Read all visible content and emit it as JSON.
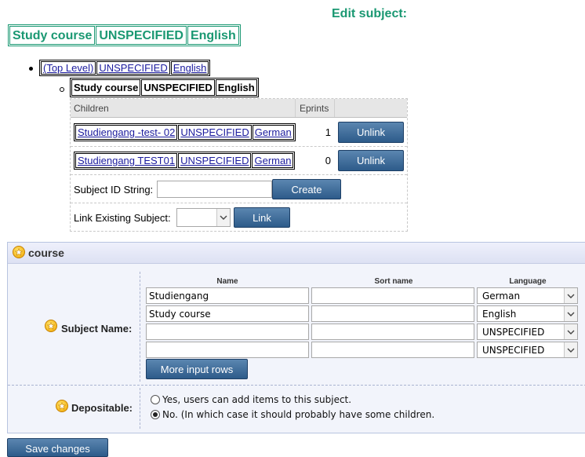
{
  "page_title": "Edit subject:",
  "subject_names": [
    "Study course",
    "UNSPECIFIED",
    "English"
  ],
  "tree": {
    "top_links": [
      "(Top Level)",
      "UNSPECIFIED",
      "English"
    ],
    "current": [
      "Study course",
      "UNSPECIFIED",
      "English"
    ]
  },
  "children_table": {
    "header_children": "Children",
    "header_eprints": "Eprints",
    "rows": [
      {
        "links": [
          "Studiengang -test- 02",
          "UNSPECIFIED",
          "German"
        ],
        "eprints": "1",
        "action": "Unlink"
      },
      {
        "links": [
          "Studiengang TEST01",
          "UNSPECIFIED",
          "German"
        ],
        "eprints": "0",
        "action": "Unlink"
      }
    ],
    "subject_id_label": "Subject ID String:",
    "subject_id_value": "",
    "create_label": "Create",
    "link_existing_label": "Link Existing Subject:",
    "link_existing_value": "",
    "link_label": "Link"
  },
  "course_panel": {
    "title": "course",
    "columns": {
      "name": "Name",
      "sort_name": "Sort name",
      "language": "Language"
    },
    "subject_name_label": "Subject Name:",
    "rows": [
      {
        "name": "Studiengang",
        "sort_name": "",
        "language": "German"
      },
      {
        "name": "Study course",
        "sort_name": "",
        "language": "English"
      },
      {
        "name": "",
        "sort_name": "",
        "language": "UNSPECIFIED"
      },
      {
        "name": "",
        "sort_name": "",
        "language": "UNSPECIFIED"
      }
    ],
    "more_rows_label": "More input rows",
    "depositable_label": "Depositable:",
    "depositable_options": [
      {
        "label": "Yes, users can add items to this subject.",
        "selected": false
      },
      {
        "label": "No. (In which case it should probably have some children.",
        "selected": true
      }
    ]
  },
  "save_label": "Save changes",
  "colors": {
    "title_green": "#1a9872",
    "link_blue": "#1b1b9e",
    "button_blue": "#2d5b8a"
  },
  "icons": {
    "star": "star-icon",
    "select_arrow": "chevron-down-icon"
  }
}
